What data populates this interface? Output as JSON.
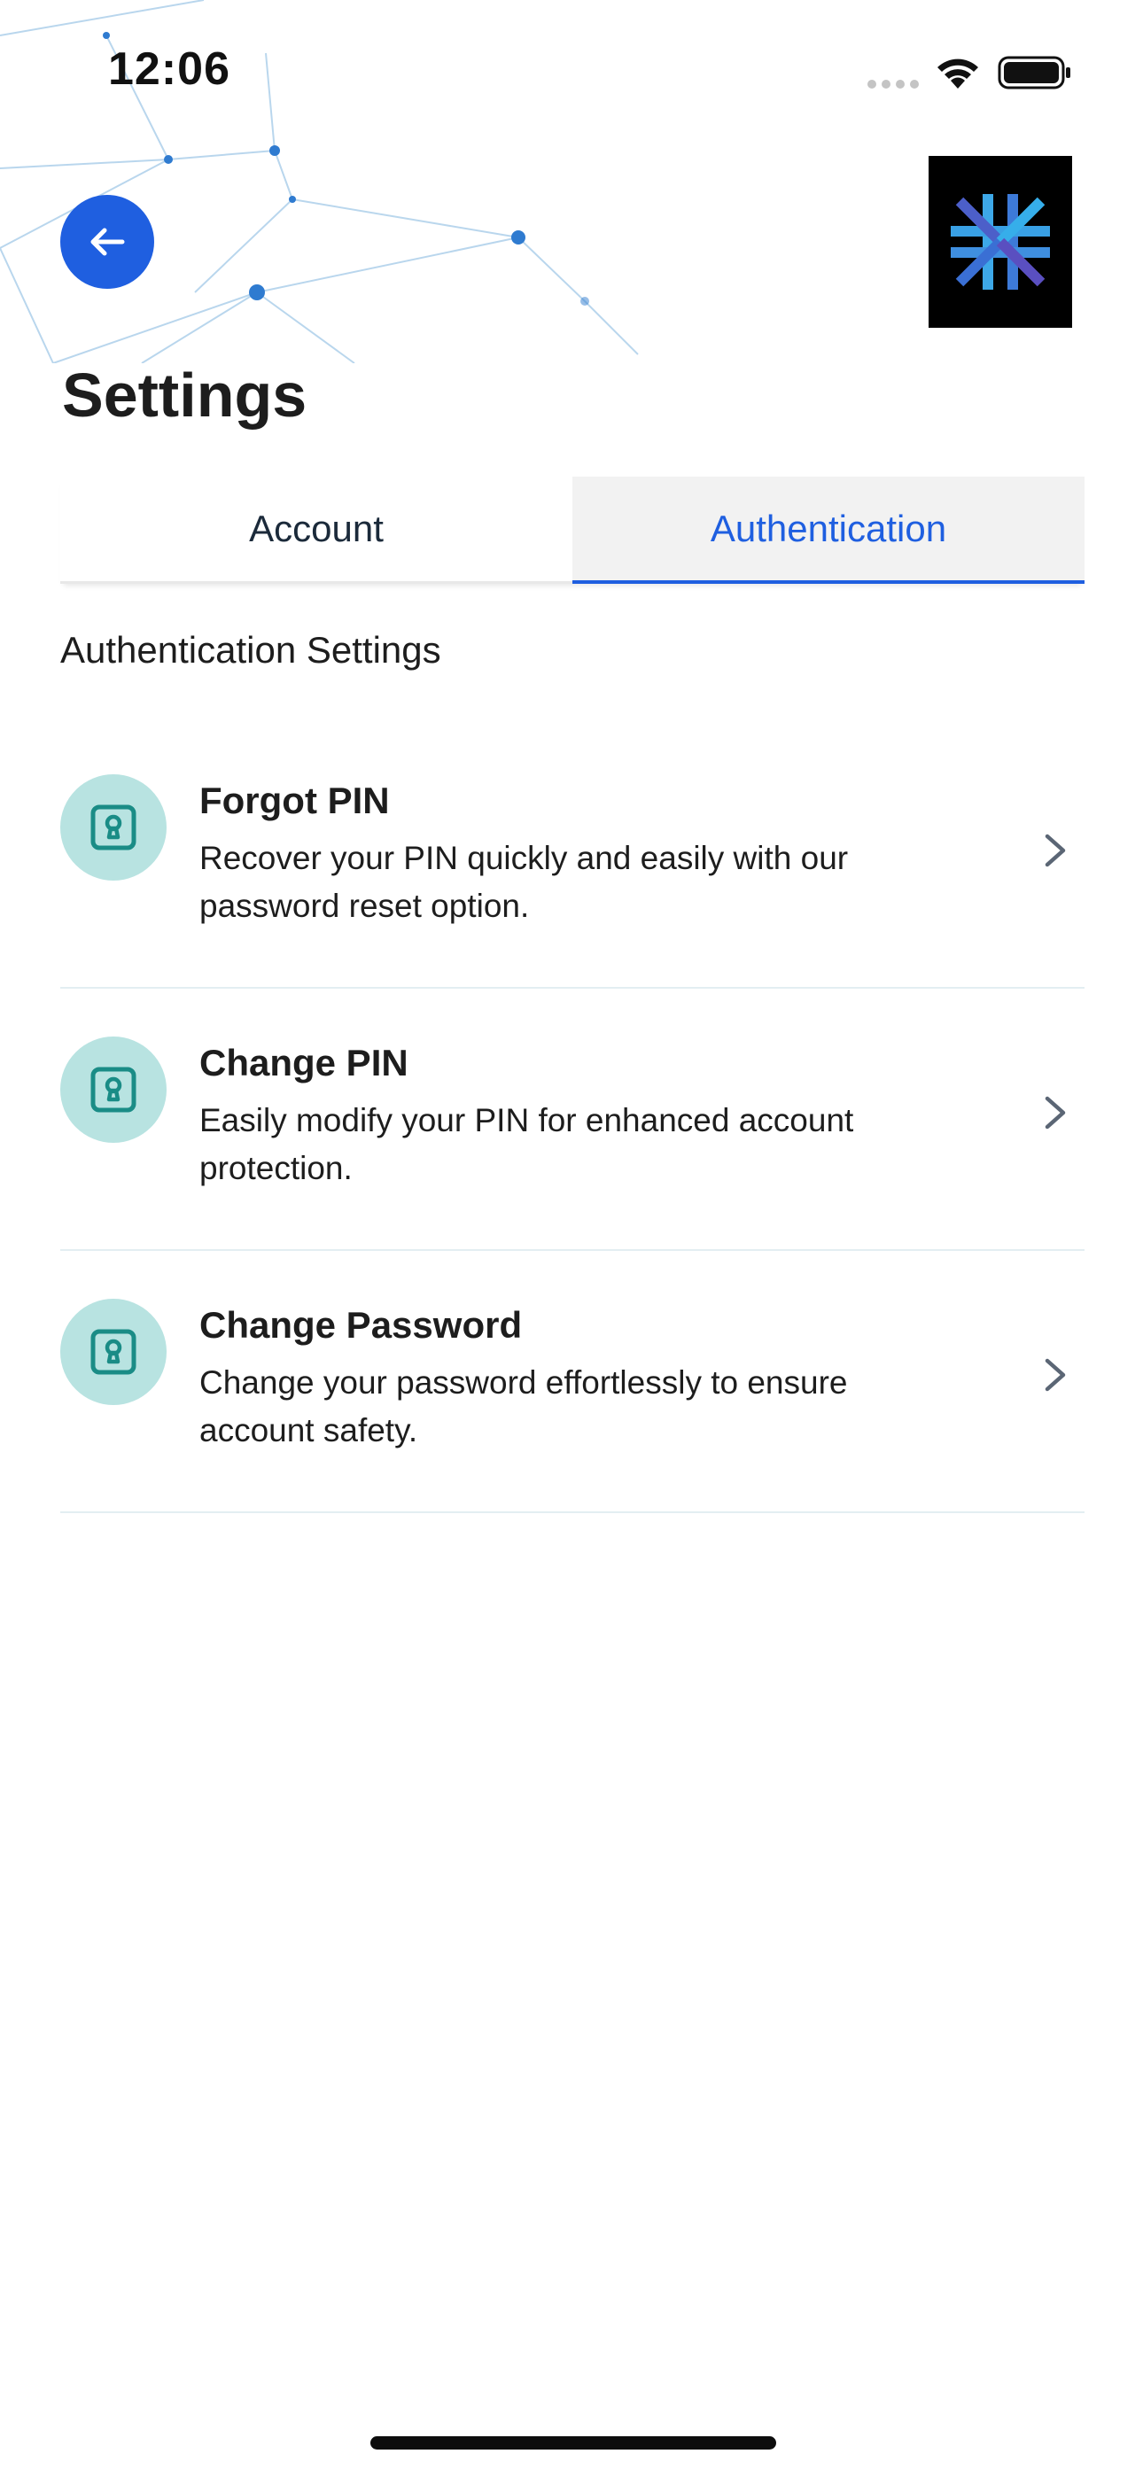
{
  "status_bar": {
    "time": "12:06",
    "icons": [
      "signal-dots-icon",
      "wifi-icon",
      "battery-icon"
    ]
  },
  "header": {
    "back_icon": "arrow-left-icon",
    "logo": "asterisk-logo",
    "title": "Settings"
  },
  "tabs": [
    {
      "label": "Account",
      "active": false
    },
    {
      "label": "Authentication",
      "active": true
    }
  ],
  "section": {
    "heading": "Authentication Settings"
  },
  "items": [
    {
      "title": "Forgot PIN",
      "description": "Recover your PIN quickly and easily with our password reset option.",
      "icon": "keyhole-lock-icon"
    },
    {
      "title": "Change PIN",
      "description": "Easily modify your PIN for enhanced account protection.",
      "icon": "keyhole-lock-icon"
    },
    {
      "title": "Change Password",
      "description": "Change your password effortlessly to ensure account safety.",
      "icon": "keyhole-lock-icon"
    }
  ],
  "colors": {
    "accent": "#1f5fe0",
    "icon_bg": "#b8e3e1",
    "icon_fg": "#1a8c86",
    "tab_active_bg": "#f2f2f2"
  }
}
